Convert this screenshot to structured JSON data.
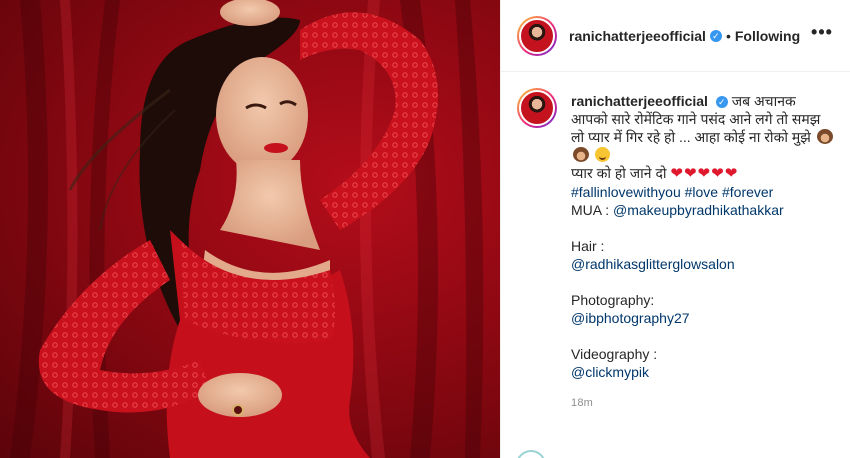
{
  "post": {
    "username": "ranichatterjeeofficial",
    "verified_icon": "verified-badge-icon",
    "separator": "•",
    "follow_status": "Following",
    "more_label": "•••"
  },
  "caption": {
    "username": "ranichatterjeeofficial",
    "line1": "जब अचानक आपको सारे रोमेंटिक गाने पसंद आने लगे तो समझ लो प्यार में गिर रहे हो ... आहा कोई ना रोको मुझे",
    "line2": "प्यार को हो जाने दो",
    "hearts": "❤❤❤❤❤",
    "hashtags": [
      "#fallinlovewithyou",
      "#love",
      "#forever"
    ],
    "mua_label": "MUA : ",
    "mua_handle": "@makeupbyradhikathakkar",
    "hair_label": "Hair :",
    "hair_handle": "@radhikasglitterglowsalon",
    "photo_label": "Photography:",
    "photo_handle": "@ibphotography27",
    "video_label": "Videography :",
    "video_handle": "@clickmypik",
    "time": "18m"
  },
  "colors": {
    "link": "#00376b",
    "verified": "#3897f0",
    "heart": "#e0182d",
    "photo_background": "#8e0812"
  }
}
